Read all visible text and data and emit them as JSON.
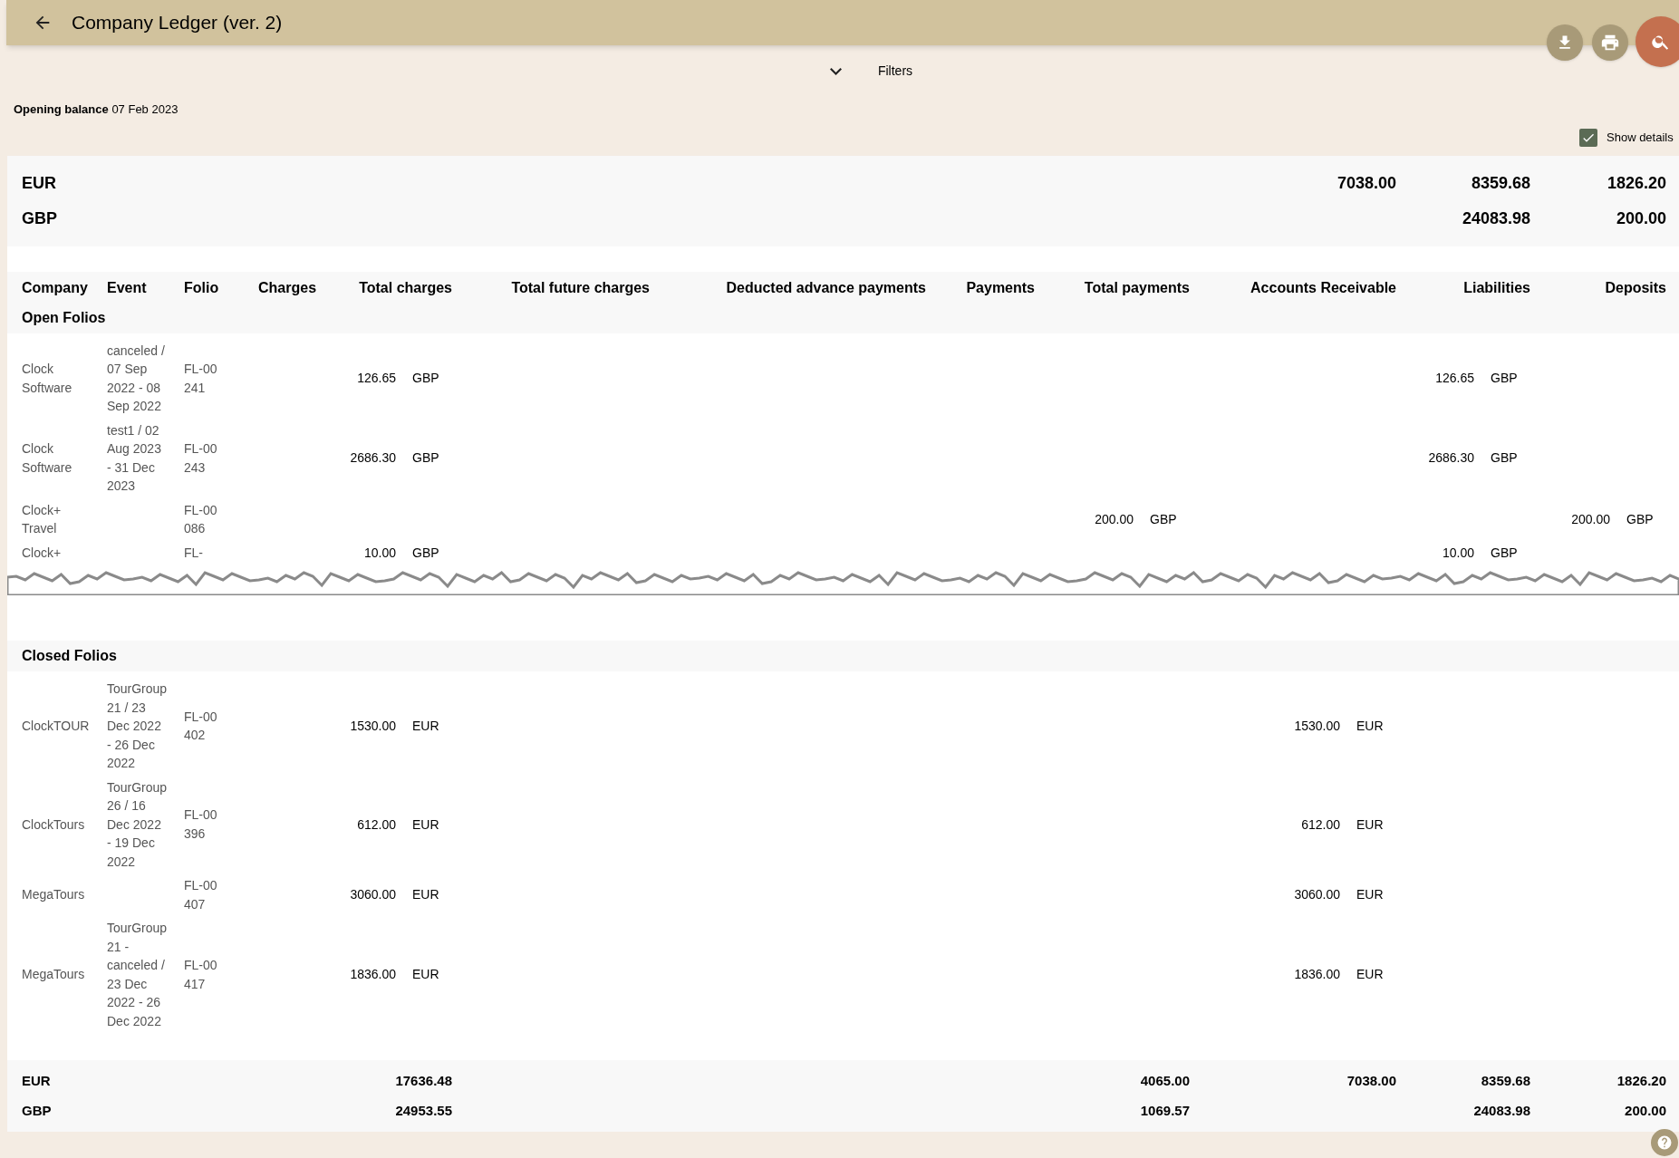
{
  "header": {
    "title": "Company Ledger (ver. 2)"
  },
  "filters": {
    "label": "Filters",
    "expanded": false
  },
  "opening_balance": {
    "label": "Opening balance",
    "date": "07 Feb 2023"
  },
  "show_details": {
    "label": "Show details",
    "checked": true
  },
  "opening_totals": [
    {
      "currency": "EUR",
      "values": {
        "accounts_receivable": "7038.00",
        "liabilities": "8359.68",
        "deposits": "1826.20"
      }
    },
    {
      "currency": "GBP",
      "values": {
        "liabilities": "24083.98",
        "deposits": "200.00"
      }
    }
  ],
  "columns": [
    "Company",
    "Event",
    "Folio",
    "Charges",
    "Total charges",
    "Total future charges",
    "Deducted advance payments",
    "Payments",
    "Total payments",
    "Accounts Receivable",
    "Liabilities",
    "Deposits"
  ],
  "sections": [
    {
      "title": "Open Folios",
      "torn": true,
      "rows": [
        {
          "company": "Clock Software",
          "event": "canceled / 07 Sep 2022 - 08 Sep 2022",
          "folio": "FL-00241",
          "values": {
            "total_charges": {
              "amount": "126.65",
              "currency": "GBP"
            },
            "liabilities": {
              "amount": "126.65",
              "currency": "GBP"
            }
          }
        },
        {
          "company": "Clock Software",
          "event": "test1 / 02 Aug 2023 - 31 Dec 2023",
          "folio": "FL-00243",
          "values": {
            "total_charges": {
              "amount": "2686.30",
              "currency": "GBP"
            },
            "liabilities": {
              "amount": "2686.30",
              "currency": "GBP"
            }
          }
        },
        {
          "company": "Clock+ Travel",
          "folio": "FL-00086",
          "values": {
            "total_payments": {
              "amount": "200.00",
              "currency": "GBP"
            },
            "deposits": {
              "amount": "200.00",
              "currency": "GBP"
            }
          }
        },
        {
          "company": "Clock+",
          "folio": "FL-",
          "values": {
            "total_charges": {
              "amount": "10.00",
              "currency": "GBP"
            },
            "liabilities": {
              "amount": "10.00",
              "currency": "GBP"
            }
          }
        }
      ]
    },
    {
      "title": "Closed Folios",
      "rows": [
        {
          "company": "ClockTOUR",
          "event": "TourGroup 21 / 23 Dec 2022 - 26 Dec 2022",
          "folio": "FL-00402",
          "values": {
            "total_charges": {
              "amount": "1530.00",
              "currency": "EUR"
            },
            "accounts_receivable": {
              "amount": "1530.00",
              "currency": "EUR"
            }
          }
        },
        {
          "company": "ClockTours",
          "event": "TourGroup 26 / 16 Dec 2022 - 19 Dec 2022",
          "folio": "FL-00396",
          "values": {
            "total_charges": {
              "amount": "612.00",
              "currency": "EUR"
            },
            "accounts_receivable": {
              "amount": "612.00",
              "currency": "EUR"
            }
          }
        },
        {
          "company": "MegaTours",
          "folio": "FL-00407",
          "values": {
            "total_charges": {
              "amount": "3060.00",
              "currency": "EUR"
            },
            "accounts_receivable": {
              "amount": "3060.00",
              "currency": "EUR"
            }
          }
        },
        {
          "company": "MegaTours",
          "event": "TourGroup 21 - canceled / 23 Dec 2022 - 26 Dec 2022",
          "folio": "FL-00417",
          "values": {
            "total_charges": {
              "amount": "1836.00",
              "currency": "EUR"
            },
            "accounts_receivable": {
              "amount": "1836.00",
              "currency": "EUR"
            }
          }
        }
      ]
    }
  ],
  "totals": [
    {
      "currency": "EUR",
      "values": {
        "total_charges": "17636.48",
        "total_payments": "4065.00",
        "accounts_receivable": "7038.00",
        "liabilities": "8359.68",
        "deposits": "1826.20"
      }
    },
    {
      "currency": "GBP",
      "values": {
        "total_charges": "24953.55",
        "total_payments": "1069.57",
        "liabilities": "24083.98",
        "deposits": "200.00"
      }
    }
  ]
}
